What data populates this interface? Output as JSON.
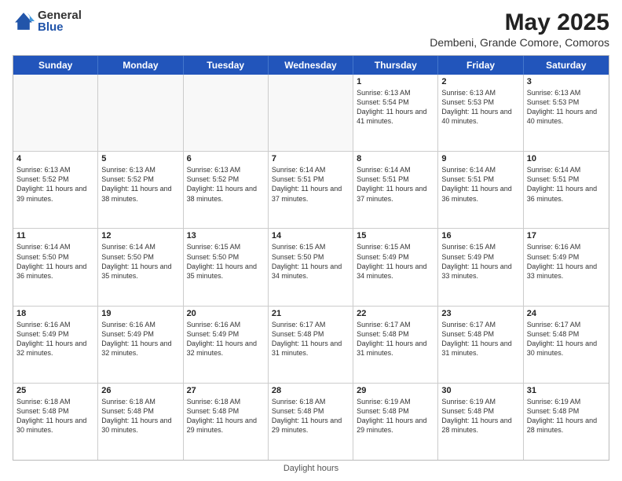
{
  "header": {
    "logo_general": "General",
    "logo_blue": "Blue",
    "title": "May 2025",
    "subtitle": "Dembeni, Grande Comore, Comoros"
  },
  "days_of_week": [
    "Sunday",
    "Monday",
    "Tuesday",
    "Wednesday",
    "Thursday",
    "Friday",
    "Saturday"
  ],
  "footer": "Daylight hours",
  "weeks": [
    [
      {
        "day": "",
        "info": ""
      },
      {
        "day": "",
        "info": ""
      },
      {
        "day": "",
        "info": ""
      },
      {
        "day": "",
        "info": ""
      },
      {
        "day": "1",
        "info": "Sunrise: 6:13 AM\nSunset: 5:54 PM\nDaylight: 11 hours and 41 minutes."
      },
      {
        "day": "2",
        "info": "Sunrise: 6:13 AM\nSunset: 5:53 PM\nDaylight: 11 hours and 40 minutes."
      },
      {
        "day": "3",
        "info": "Sunrise: 6:13 AM\nSunset: 5:53 PM\nDaylight: 11 hours and 40 minutes."
      }
    ],
    [
      {
        "day": "4",
        "info": "Sunrise: 6:13 AM\nSunset: 5:52 PM\nDaylight: 11 hours and 39 minutes."
      },
      {
        "day": "5",
        "info": "Sunrise: 6:13 AM\nSunset: 5:52 PM\nDaylight: 11 hours and 38 minutes."
      },
      {
        "day": "6",
        "info": "Sunrise: 6:13 AM\nSunset: 5:52 PM\nDaylight: 11 hours and 38 minutes."
      },
      {
        "day": "7",
        "info": "Sunrise: 6:14 AM\nSunset: 5:51 PM\nDaylight: 11 hours and 37 minutes."
      },
      {
        "day": "8",
        "info": "Sunrise: 6:14 AM\nSunset: 5:51 PM\nDaylight: 11 hours and 37 minutes."
      },
      {
        "day": "9",
        "info": "Sunrise: 6:14 AM\nSunset: 5:51 PM\nDaylight: 11 hours and 36 minutes."
      },
      {
        "day": "10",
        "info": "Sunrise: 6:14 AM\nSunset: 5:51 PM\nDaylight: 11 hours and 36 minutes."
      }
    ],
    [
      {
        "day": "11",
        "info": "Sunrise: 6:14 AM\nSunset: 5:50 PM\nDaylight: 11 hours and 36 minutes."
      },
      {
        "day": "12",
        "info": "Sunrise: 6:14 AM\nSunset: 5:50 PM\nDaylight: 11 hours and 35 minutes."
      },
      {
        "day": "13",
        "info": "Sunrise: 6:15 AM\nSunset: 5:50 PM\nDaylight: 11 hours and 35 minutes."
      },
      {
        "day": "14",
        "info": "Sunrise: 6:15 AM\nSunset: 5:50 PM\nDaylight: 11 hours and 34 minutes."
      },
      {
        "day": "15",
        "info": "Sunrise: 6:15 AM\nSunset: 5:49 PM\nDaylight: 11 hours and 34 minutes."
      },
      {
        "day": "16",
        "info": "Sunrise: 6:15 AM\nSunset: 5:49 PM\nDaylight: 11 hours and 33 minutes."
      },
      {
        "day": "17",
        "info": "Sunrise: 6:16 AM\nSunset: 5:49 PM\nDaylight: 11 hours and 33 minutes."
      }
    ],
    [
      {
        "day": "18",
        "info": "Sunrise: 6:16 AM\nSunset: 5:49 PM\nDaylight: 11 hours and 32 minutes."
      },
      {
        "day": "19",
        "info": "Sunrise: 6:16 AM\nSunset: 5:49 PM\nDaylight: 11 hours and 32 minutes."
      },
      {
        "day": "20",
        "info": "Sunrise: 6:16 AM\nSunset: 5:49 PM\nDaylight: 11 hours and 32 minutes."
      },
      {
        "day": "21",
        "info": "Sunrise: 6:17 AM\nSunset: 5:48 PM\nDaylight: 11 hours and 31 minutes."
      },
      {
        "day": "22",
        "info": "Sunrise: 6:17 AM\nSunset: 5:48 PM\nDaylight: 11 hours and 31 minutes."
      },
      {
        "day": "23",
        "info": "Sunrise: 6:17 AM\nSunset: 5:48 PM\nDaylight: 11 hours and 31 minutes."
      },
      {
        "day": "24",
        "info": "Sunrise: 6:17 AM\nSunset: 5:48 PM\nDaylight: 11 hours and 30 minutes."
      }
    ],
    [
      {
        "day": "25",
        "info": "Sunrise: 6:18 AM\nSunset: 5:48 PM\nDaylight: 11 hours and 30 minutes."
      },
      {
        "day": "26",
        "info": "Sunrise: 6:18 AM\nSunset: 5:48 PM\nDaylight: 11 hours and 30 minutes."
      },
      {
        "day": "27",
        "info": "Sunrise: 6:18 AM\nSunset: 5:48 PM\nDaylight: 11 hours and 29 minutes."
      },
      {
        "day": "28",
        "info": "Sunrise: 6:18 AM\nSunset: 5:48 PM\nDaylight: 11 hours and 29 minutes."
      },
      {
        "day": "29",
        "info": "Sunrise: 6:19 AM\nSunset: 5:48 PM\nDaylight: 11 hours and 29 minutes."
      },
      {
        "day": "30",
        "info": "Sunrise: 6:19 AM\nSunset: 5:48 PM\nDaylight: 11 hours and 28 minutes."
      },
      {
        "day": "31",
        "info": "Sunrise: 6:19 AM\nSunset: 5:48 PM\nDaylight: 11 hours and 28 minutes."
      }
    ]
  ]
}
